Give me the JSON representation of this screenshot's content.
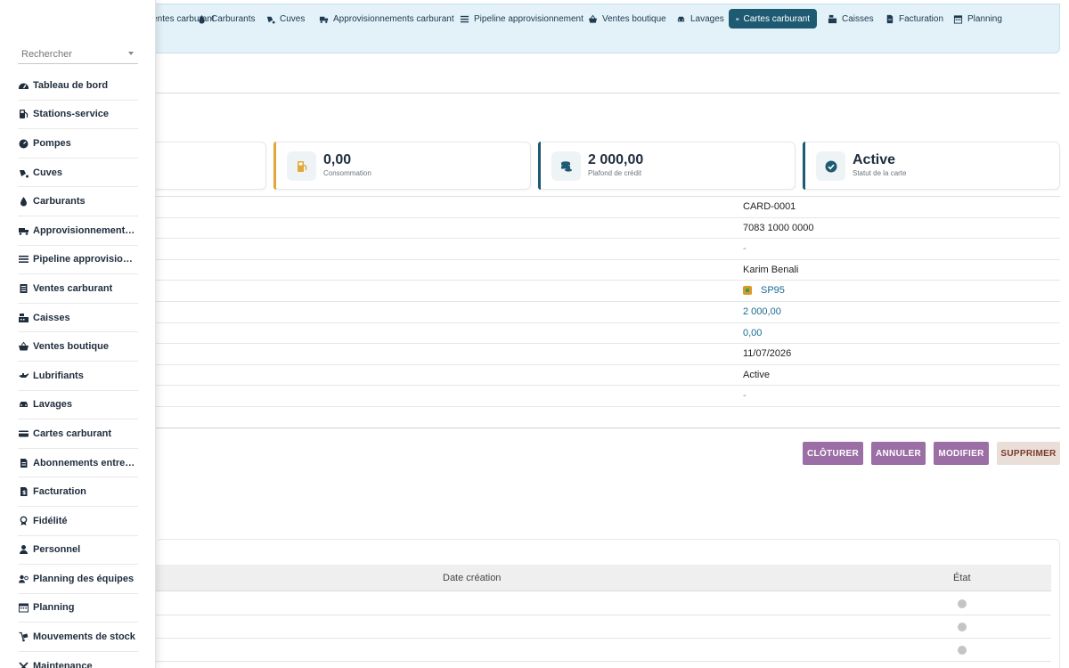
{
  "topmenu": {
    "items": [
      {
        "label": "Ventes carburant",
        "icon": "receipt-icon",
        "active": false
      },
      {
        "label": "Carburants",
        "icon": "droplet-icon",
        "active": false
      },
      {
        "label": "Cuves",
        "icon": "tank-icon",
        "active": false
      },
      {
        "label": "Approvisionnements carburant",
        "icon": "truck-icon",
        "active": false
      },
      {
        "label": "Pipeline approvisionnement",
        "icon": "list-icon",
        "active": false
      },
      {
        "label": "Ventes boutique",
        "icon": "basket-icon",
        "active": false
      },
      {
        "label": "Lavages",
        "icon": "car-icon",
        "active": false
      },
      {
        "label": "Cartes carburant",
        "icon": "credit-card-icon",
        "active": true
      },
      {
        "label": "Caisses",
        "icon": "cash-register-icon",
        "active": false
      },
      {
        "label": "Facturation",
        "icon": "invoice-icon",
        "active": false
      },
      {
        "label": "Planning",
        "icon": "calendar-icon",
        "active": false
      }
    ]
  },
  "stats": [
    {
      "value": "0,00",
      "label": "Consommation",
      "icon": "fuel-pump-icon",
      "accent": "#e0a83a"
    },
    {
      "value": "2 000,00",
      "label": "Plafond de crédit",
      "icon": "coins-icon",
      "accent": "#1e5a72"
    },
    {
      "value": "Active",
      "label": "Statut de la carte",
      "icon": "check-circle-icon",
      "accent": "#1e5a72"
    }
  ],
  "details": {
    "rows": [
      {
        "value": "CARD-0001",
        "style": "plain"
      },
      {
        "value": "7083 1000 0000",
        "style": "plain"
      },
      {
        "value": "-",
        "style": "dash"
      },
      {
        "value": "Karim Benali",
        "style": "plain"
      },
      {
        "value": "SP95",
        "style": "fuel"
      },
      {
        "value": "2 000,00",
        "style": "link"
      },
      {
        "value": "0,00",
        "style": "link"
      },
      {
        "value": "11/07/2026",
        "style": "plain"
      },
      {
        "value": "Active",
        "style": "plain"
      },
      {
        "value": "-",
        "style": "dash"
      }
    ]
  },
  "actions": {
    "close_label": "CLÔTURER",
    "cancel_label": "ANNULER",
    "edit_label": "MODIFIER",
    "delete_label": "SUPPRIMER"
  },
  "subtable": {
    "col_date": "Date création",
    "col_state": "État",
    "row_count": 3
  },
  "sidebar": {
    "search_placeholder": "Rechercher",
    "items": [
      {
        "label": "Tableau de bord",
        "icon": "dashboard-icon"
      },
      {
        "label": "Stations-service",
        "icon": "gas-station-icon"
      },
      {
        "label": "Pompes",
        "icon": "gauge-icon"
      },
      {
        "label": "Cuves",
        "icon": "tank-icon"
      },
      {
        "label": "Carburants",
        "icon": "droplet-icon"
      },
      {
        "label": "Approvisionnements carburant",
        "icon": "truck-icon"
      },
      {
        "label": "Pipeline approvisionnement",
        "icon": "list-icon"
      },
      {
        "label": "Ventes carburant",
        "icon": "receipt-icon"
      },
      {
        "label": "Caisses",
        "icon": "cash-register-icon"
      },
      {
        "label": "Ventes boutique",
        "icon": "basket-icon"
      },
      {
        "label": "Lubrifiants",
        "icon": "oil-can-icon"
      },
      {
        "label": "Lavages",
        "icon": "car-icon"
      },
      {
        "label": "Cartes carburant",
        "icon": "credit-card-icon"
      },
      {
        "label": "Abonnements entreprise",
        "icon": "contract-icon"
      },
      {
        "label": "Facturation",
        "icon": "invoice-icon"
      },
      {
        "label": "Fidélité",
        "icon": "medal-icon"
      },
      {
        "label": "Personnel",
        "icon": "user-icon"
      },
      {
        "label": "Planning des équipes",
        "icon": "users-icon"
      },
      {
        "label": "Planning",
        "icon": "calendar-icon"
      },
      {
        "label": "Mouvements de stock",
        "icon": "dolly-icon"
      },
      {
        "label": "Maintenance",
        "icon": "tools-icon"
      }
    ]
  }
}
